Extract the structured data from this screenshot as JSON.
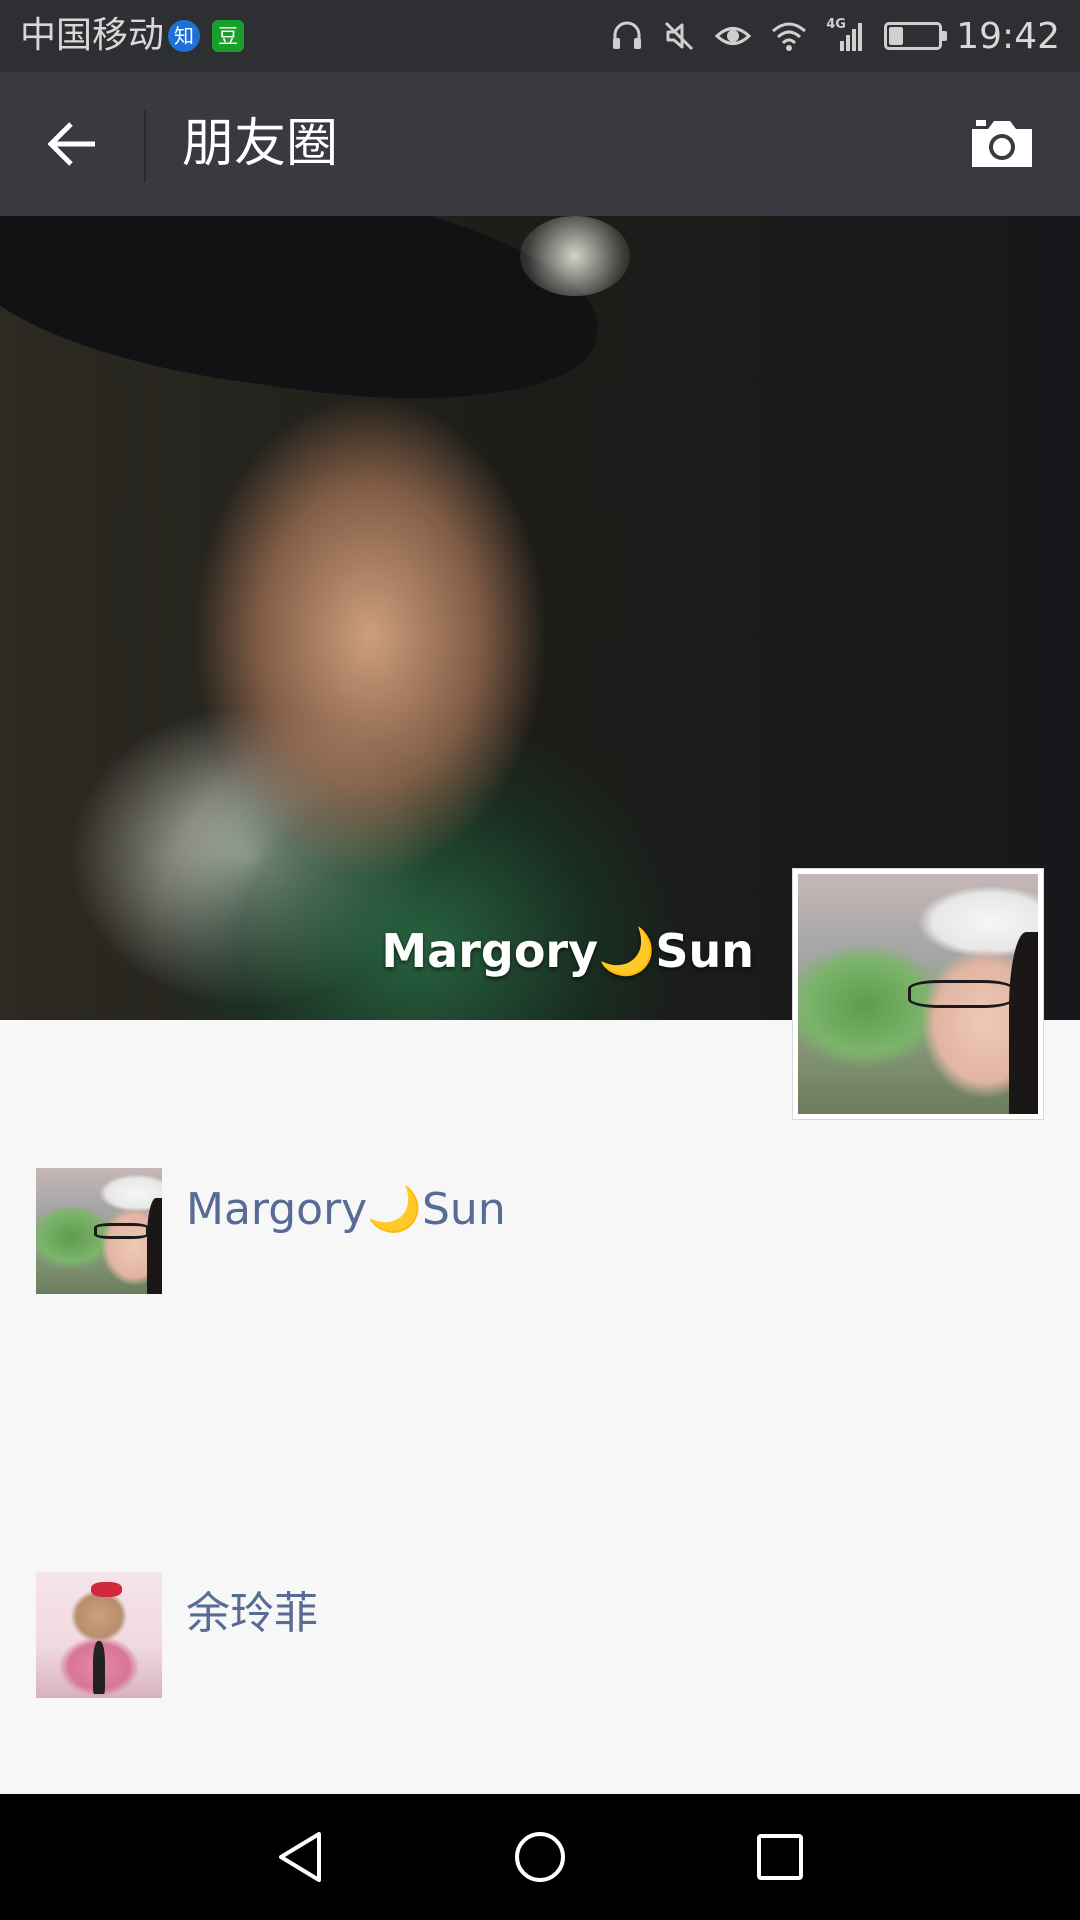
{
  "status_bar": {
    "carrier": "中国移动",
    "app_badges": [
      {
        "label": "知",
        "icon": "zhihu-icon",
        "color": "#1f6fd8"
      },
      {
        "label": "豆",
        "icon": "douban-icon",
        "color": "#1a9f2d"
      }
    ],
    "icons": [
      "headphones-icon",
      "mute-icon",
      "eye-icon",
      "wifi-icon",
      "4g-signal-icon"
    ],
    "network_label": "4G",
    "battery_level": 0.35,
    "time": "19:42"
  },
  "header": {
    "title": "朋友圈",
    "back_icon": "back-arrow-icon",
    "action_icon": "camera-icon",
    "background": "#393a3f"
  },
  "cover": {
    "user_name": "Margory🌙Sun"
  },
  "feed": [
    {
      "name": "Margory🌙Sun"
    },
    {
      "name": "余玲菲"
    }
  ],
  "colors": {
    "link_name": "#576b95",
    "page_background": "#f7f7f7",
    "status_bar": "#2e2f33"
  },
  "system_nav": {
    "icons": [
      "nav-back-icon",
      "nav-home-icon",
      "nav-recents-icon"
    ]
  }
}
